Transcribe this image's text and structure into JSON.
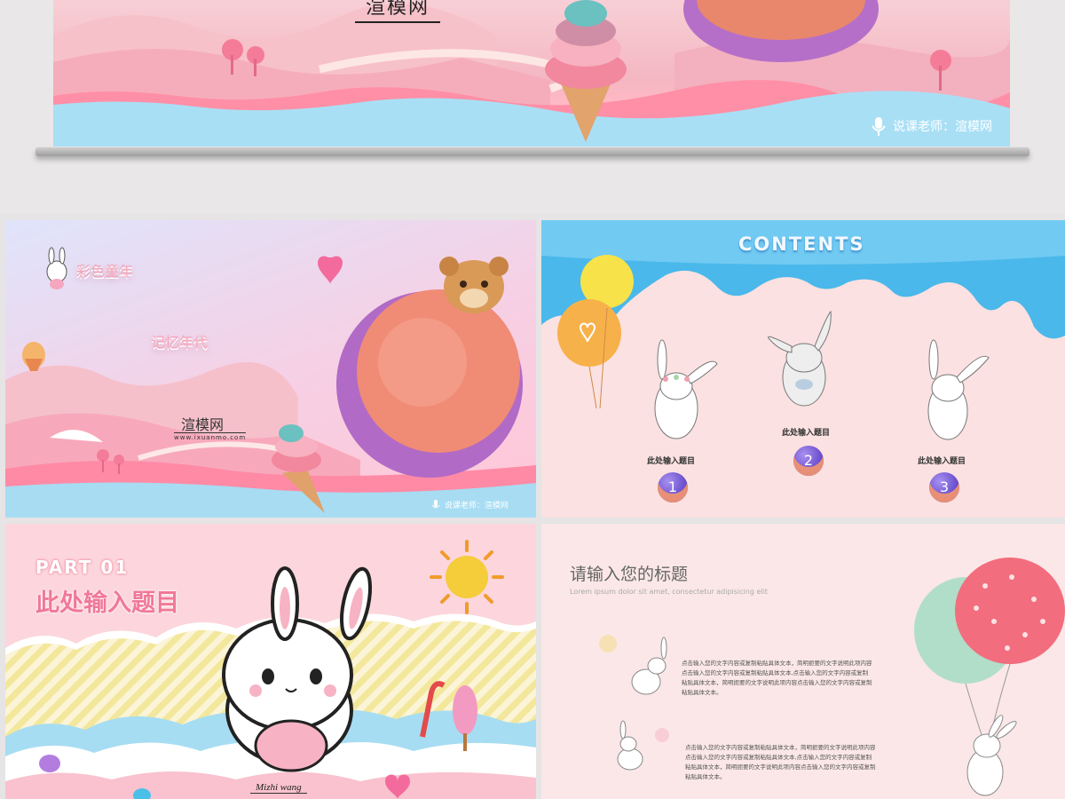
{
  "hero": {
    "site_name": "渲模网",
    "site_url": "www.ixuanmo.com",
    "lecturer": "说课老师：渲模网"
  },
  "slide_cover": {
    "title_line1": "彩色童年",
    "title_line2": "记忆年代",
    "brand": "渲模网",
    "brand_url": "www.ixuanmo.com",
    "lecturer": "说课老师：渲模网"
  },
  "slide_contents": {
    "heading": "CONTENTS",
    "items": [
      {
        "label": "此处输入题目",
        "number": "1"
      },
      {
        "label": "此处输入题目",
        "number": "2"
      },
      {
        "label": "此处输入题目",
        "number": "3"
      }
    ]
  },
  "slide_part": {
    "part": "PART 01",
    "title": "此处输入题目",
    "author": "Mizhi wang"
  },
  "slide_text": {
    "title": "请输入您的标题",
    "subtitle": "Lorem ipsum dolor sit amet, consectetur adipisicing elit",
    "paragraph1": "点击输入您的文字内容或复制粘贴具体文本，简明扼要的文字说明此项内容点击输入您的文字内容或复制粘贴具体文本,点击输入您的文字内容或复制粘贴具体文本，简明扼要的文字说明此项内容点击输入您的文字内容或复制粘贴具体文本。",
    "paragraph2": "点击输入您的文字内容或复制粘贴具体文本，简明扼要的文字说明此项内容点击输入您的文字内容或复制粘贴具体文本,点击输入您的文字内容或复制粘贴具体文本，简明扼要的文字说明此项内容点击输入您的文字内容或复制粘贴具体文本。"
  }
}
